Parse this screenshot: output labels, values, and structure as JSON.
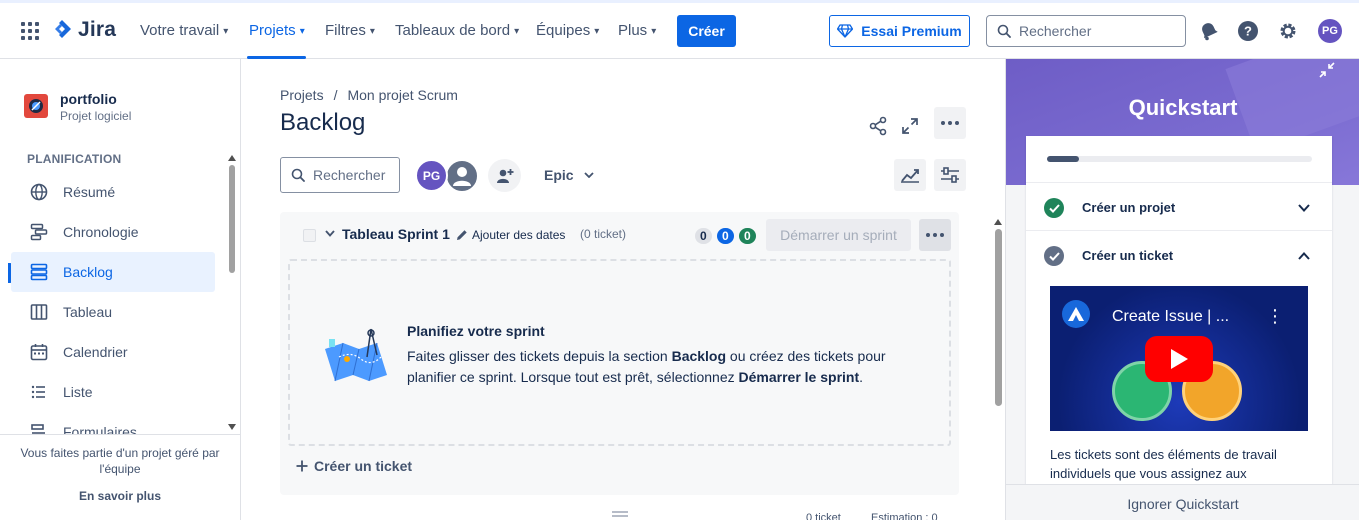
{
  "topnav": {
    "logo": "Jira",
    "items": [
      {
        "label": "Votre travail"
      },
      {
        "label": "Projets"
      },
      {
        "label": "Filtres"
      },
      {
        "label": "Tableaux de bord"
      },
      {
        "label": "Équipes"
      },
      {
        "label": "Plus"
      }
    ],
    "create_label": "Créer",
    "premium_label": "Essai Premium",
    "search_placeholder": "Rechercher",
    "avatar_initials": "PG",
    "accent_color": "#0c66e4"
  },
  "sidebar": {
    "project_name": "portfolio",
    "project_type": "Projet logiciel",
    "section": "PLANIFICATION",
    "items": [
      {
        "label": "Résumé",
        "icon": "globe-icon"
      },
      {
        "label": "Chronologie",
        "icon": "timeline-icon"
      },
      {
        "label": "Backlog",
        "icon": "backlog-icon"
      },
      {
        "label": "Tableau",
        "icon": "board-icon"
      },
      {
        "label": "Calendrier",
        "icon": "calendar-icon"
      },
      {
        "label": "Liste",
        "icon": "list-icon"
      },
      {
        "label": "Formulaires",
        "icon": "forms-icon"
      }
    ],
    "footer_text": "Vous faites partie d'un projet géré par l'équipe",
    "footer_link": "En savoir plus"
  },
  "main": {
    "breadcrumb": [
      "Projets",
      "/",
      "Mon projet Scrum"
    ],
    "title": "Backlog",
    "search_placeholder": "Rechercher",
    "avatar_initials": "PG",
    "epic_label": "Epic",
    "sprint": {
      "name": "Tableau Sprint 1",
      "add_dates": "Ajouter des dates",
      "ticket_count": "(0 ticket)",
      "counts": [
        "0",
        "0",
        "0"
      ],
      "start_label": "Démarrer un sprint",
      "more_label": "•••",
      "plan_title": "Planifiez votre sprint",
      "plan_text_1": "Faites glisser des tickets depuis la section ",
      "plan_bold_1": "Backlog",
      "plan_text_2": " ou créez des tickets pour planifier ce sprint. Lorsque tout est prêt, sélectionnez ",
      "plan_bold_2": "Démarrer le sprint",
      "plan_text_3": ".",
      "create_ticket": "Créer un ticket"
    },
    "bottom": {
      "tickets": "0 ticket",
      "estimation": "Estimation : 0"
    }
  },
  "quickstart": {
    "title": "Quickstart",
    "progress_fraction": 0.12,
    "tasks": [
      {
        "label": "Créer un projet",
        "done": true
      },
      {
        "label": "Créer un ticket",
        "done": false
      }
    ],
    "video_title": "Create Issue | ...",
    "description": "Les tickets sont des éléments de travail individuels que vous assignez aux",
    "ignore_label": "Ignorer Quickstart"
  }
}
